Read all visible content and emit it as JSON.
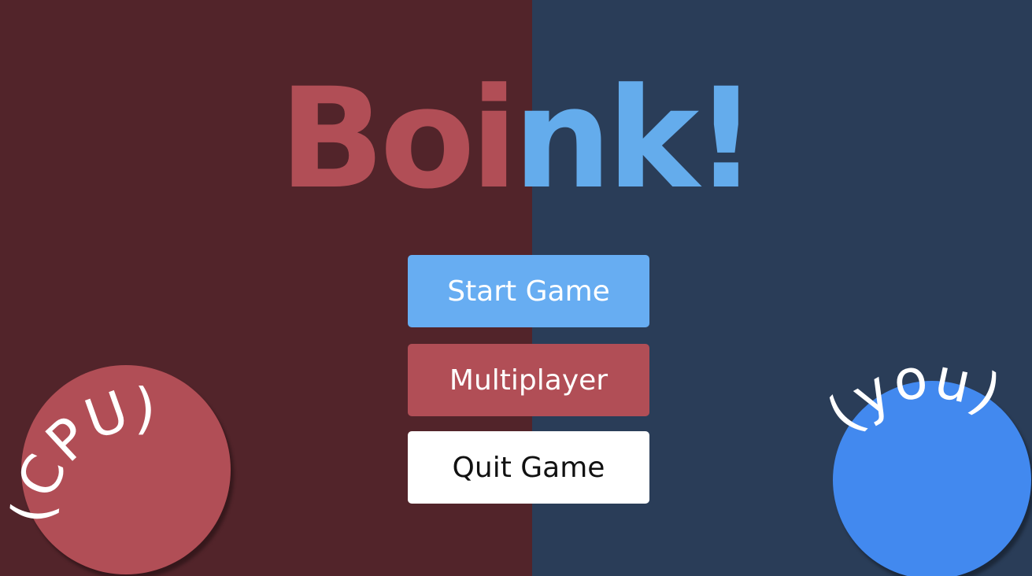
{
  "background": {
    "left_color": "#52242a",
    "right_color": "#2a3d58"
  },
  "title": {
    "part_red": "Boi",
    "part_blue": "nk!",
    "red_color": "#b14e56",
    "blue_color": "#64acec"
  },
  "menu": {
    "start_label": "Start Game",
    "multiplayer_label": "Multiplayer",
    "quit_label": "Quit Game"
  },
  "players": {
    "cpu_label": "(CPU)",
    "you_label": "(you)",
    "cpu_color": "#b14e56",
    "you_color": "#4289ef"
  }
}
